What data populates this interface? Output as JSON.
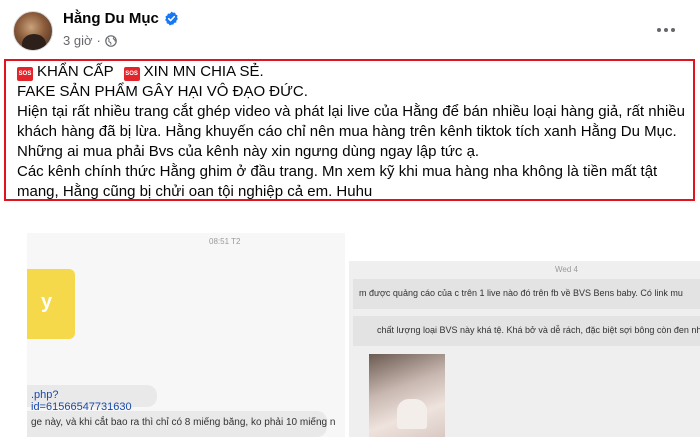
{
  "post": {
    "author": "Hằng Du Mục",
    "time": "3 giờ",
    "separator": "·"
  },
  "content": {
    "lines": [
      {
        "sos1": "SOS",
        "text1": "KHẨN CẤP",
        "sos2": "SOS",
        "text2": "XIN MN CHIA SẺ."
      },
      {
        "text": "FAKE SẢN PHẨM GÂY HẠI VÔ ĐẠO ĐỨC."
      },
      {
        "text": "Hiện tại rất nhiều trang cắt ghép video và phát lại live của Hằng để bán nhiều loại hàng giả, rất nhiều"
      },
      {
        "text": "khách hàng đã bị lừa. Hằng khuyến cáo chỉ nên mua hàng trên kênh tiktok tích xanh Hằng Du Mục."
      },
      {
        "text": "Những ai mua phải Bvs của kênh này xin ngưng dùng ngay lập tức ạ."
      },
      {
        "text": "Các kênh chính thức Hằng ghim ở đầu trang. Mn xem kỹ khi mua hàng nha không là tiền mất tật"
      },
      {
        "text": "mang, Hằng cũng bị chửi oan tội nghiệp cả em. Huhu"
      }
    ]
  },
  "images": {
    "left": {
      "time": "08:51 T2",
      "yellow_letter": "y",
      "link": ".php?id=61566547731630",
      "message": "ge này, và khi cắt bao ra thì chỉ có 8 miếng băng, ko phải 10 miếng n"
    },
    "right": {
      "time": "Wed 4",
      "message1": "m được quảng cáo của c trên 1 live nào đó trên fb về BVS Bens baby. Có link mu",
      "message2": "chất lượng loại BVS này khá tệ. Khá bở và dễ rách, đặc biệt sợi bông còn đen nh"
    }
  },
  "colors": {
    "highlight_border": "#e0141f",
    "sos_badge": "#e3242b",
    "verified": "#1877f2",
    "meta_text": "#65676b"
  },
  "icons": {
    "verified": "verified-badge-icon",
    "globe": "globe-icon",
    "more": "more-options-icon",
    "sos": "sos-emoji-icon"
  }
}
